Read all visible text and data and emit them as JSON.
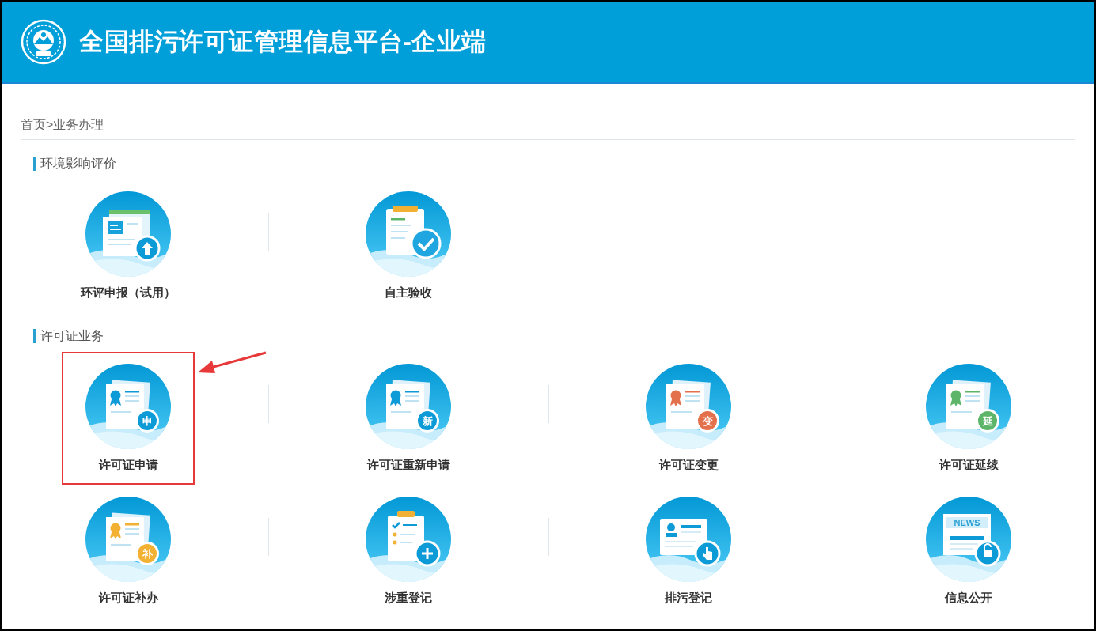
{
  "header": {
    "title": "全国排污许可证管理信息平台-企业端"
  },
  "breadcrumb": "首页>业务办理",
  "sections": [
    {
      "title": "环境影响评价",
      "items": [
        {
          "label": "环评申报（试用）",
          "kind": "upload",
          "highlighted": false
        },
        {
          "label": "自主验收",
          "kind": "checklist",
          "highlighted": false
        }
      ]
    },
    {
      "title": "许可证业务",
      "items": [
        {
          "label": "许可证申请",
          "kind": "certificate",
          "badge": "申",
          "color": "#0c9bd6",
          "highlighted": true
        },
        {
          "label": "许可证重新申请",
          "kind": "certificate",
          "badge": "新",
          "color": "#0c9bd6",
          "highlighted": false
        },
        {
          "label": "许可证变更",
          "kind": "certificate",
          "badge": "变",
          "color": "#e3714c",
          "highlighted": false
        },
        {
          "label": "许可证延续",
          "kind": "certificate",
          "badge": "延",
          "color": "#5cb568",
          "highlighted": false
        },
        {
          "label": "许可证补办",
          "kind": "certificate",
          "badge": "补",
          "color": "#f2b133",
          "highlighted": false
        },
        {
          "label": "涉重登记",
          "kind": "clipboard",
          "highlighted": false
        },
        {
          "label": "排污登记",
          "kind": "registration",
          "highlighted": false
        },
        {
          "label": "信息公开",
          "kind": "news",
          "badge": "NEWS",
          "highlighted": false
        }
      ]
    }
  ]
}
